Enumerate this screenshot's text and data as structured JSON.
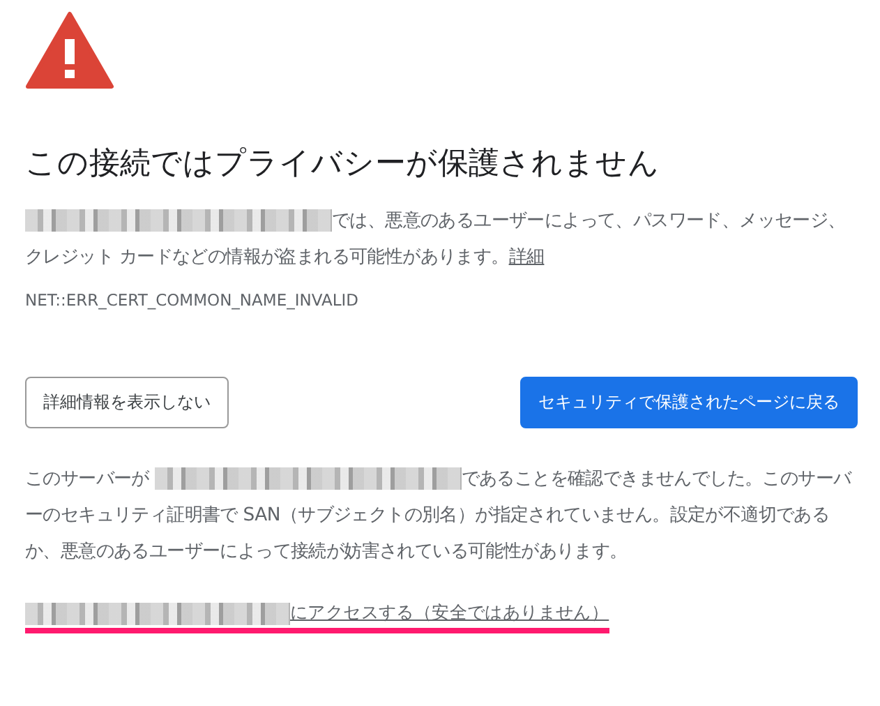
{
  "title": "この接続ではプライバシーが保護されません",
  "message": [
    {
      "kind": "redacted"
    },
    {
      "kind": "text",
      "text": "では、悪意のあるユーザーによって、パスワード、メッセージ、クレジット カードなどの情報が盗まれる可能性があります。"
    },
    {
      "kind": "link",
      "text": "詳細"
    }
  ],
  "error_code": "NET::ERR_CERT_COMMON_NAME_INVALID",
  "buttons": [
    {
      "label": "詳細情報を表示しない",
      "kind": "secondary"
    },
    {
      "label": "セキュリティで保護されたページに戻る",
      "kind": "primary"
    }
  ],
  "details": [
    {
      "kind": "text",
      "text": "このサーバーが "
    },
    {
      "kind": "redacted"
    },
    {
      "kind": "text",
      "text": "であることを確認できませんでした。このサーバーのセキュリティ証明書で SAN（サブジェクトの別名）が指定されていません。設定が不適切であるか、悪意のあるユーザーによって接続が妨害されている可能性があります。"
    }
  ],
  "proceed": {
    "marked": true,
    "parts": [
      {
        "kind": "redacted"
      },
      {
        "kind": "link",
        "text": "にアクセスする（安全ではありません）"
      }
    ]
  }
}
